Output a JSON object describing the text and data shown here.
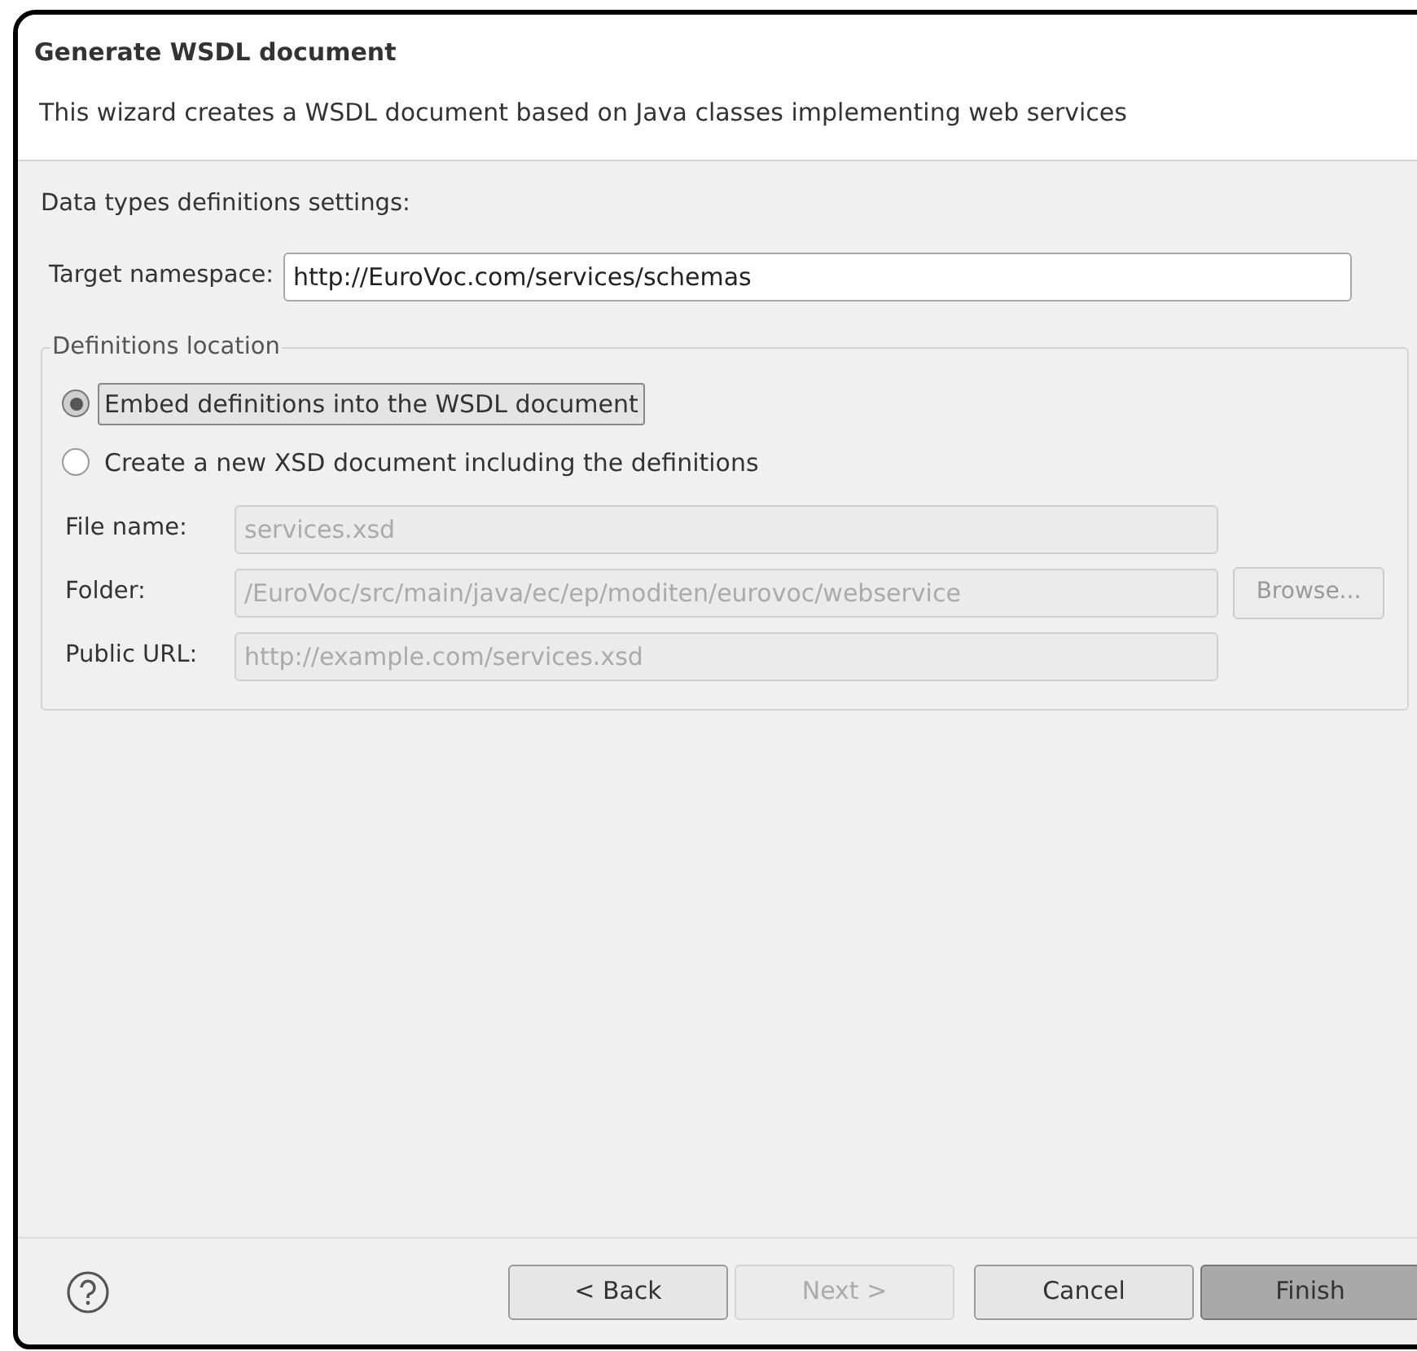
{
  "header": {
    "title": "Generate WSDL document",
    "description": "This wizard creates a WSDL document based on Java classes implementing web services"
  },
  "section_label": "Data types definitions settings:",
  "target_namespace": {
    "label": "Target namespace:",
    "value": "http://EuroVoc.com/services/schemas"
  },
  "definitions_location": {
    "legend": "Definitions location",
    "options": [
      {
        "label": "Embed definitions into the WSDL document",
        "selected": true
      },
      {
        "label": "Create a new XSD document including the definitions",
        "selected": false
      }
    ],
    "fields": [
      {
        "label": "File name:",
        "value": "services.xsd",
        "disabled": true
      },
      {
        "label": "Folder:",
        "value": "/EuroVoc/src/main/java/ec/ep/moditen/eurovoc/webservice",
        "disabled": true,
        "button": "Browse..."
      },
      {
        "label": "Public URL:",
        "value": "http://example.com/services.xsd",
        "disabled": true
      }
    ]
  },
  "buttons": [
    {
      "label": "< Back",
      "disabled": false,
      "default": false
    },
    {
      "label": "Next >",
      "disabled": true,
      "default": false
    },
    {
      "label": "Cancel",
      "disabled": false,
      "default": false
    },
    {
      "label": "Finish",
      "disabled": false,
      "default": true
    }
  ]
}
